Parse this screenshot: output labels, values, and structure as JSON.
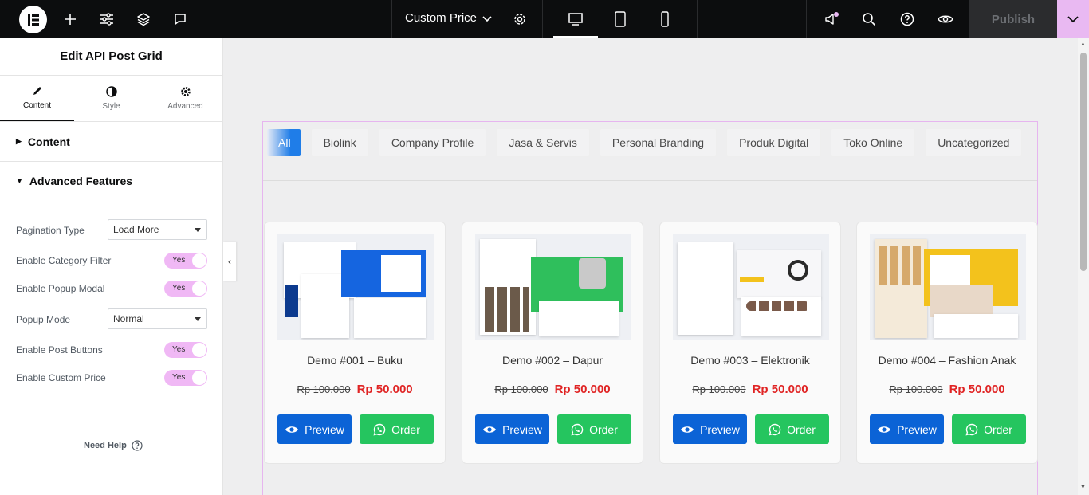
{
  "topbar": {
    "page_title": "Custom Price",
    "publish_label": "Publish",
    "icons": [
      "elementor-logo-icon",
      "add-icon",
      "settings-sliders-icon",
      "layers-icon",
      "comment-icon",
      "chevron-down-icon",
      "gear-icon",
      "desktop-icon",
      "tablet-icon",
      "mobile-icon",
      "megaphone-icon",
      "search-icon",
      "help-icon",
      "eye-icon"
    ]
  },
  "panel": {
    "title": "Edit API Post Grid",
    "tabs": [
      {
        "label": "Content",
        "icon": "pencil-icon"
      },
      {
        "label": "Style",
        "icon": "half-circle-icon"
      },
      {
        "label": "Advanced",
        "icon": "gear-icon"
      }
    ],
    "content_section": "Content",
    "advanced_section": "Advanced Features",
    "controls": {
      "pagination_type_label": "Pagination Type",
      "pagination_type_value": "Load More",
      "category_filter_label": "Enable Category Filter",
      "category_filter_value": "Yes",
      "popup_modal_label": "Enable Popup Modal",
      "popup_modal_value": "Yes",
      "popup_mode_label": "Popup Mode",
      "popup_mode_value": "Normal",
      "post_buttons_label": "Enable Post Buttons",
      "post_buttons_value": "Yes",
      "custom_price_label": "Enable Custom Price",
      "custom_price_value": "Yes"
    },
    "help": "Need Help"
  },
  "filters": [
    "All",
    "Biolink",
    "Company Profile",
    "Jasa & Servis",
    "Personal Branding",
    "Produk Digital",
    "Toko Online",
    "Uncategorized"
  ],
  "cards": [
    {
      "title": "Demo #001 – Buku",
      "old_price": "Rp 100.000",
      "price": "Rp 50.000",
      "preview": "Preview",
      "order": "Order",
      "accent": "#1565e0"
    },
    {
      "title": "Demo #002 – Dapur",
      "old_price": "Rp 100.000",
      "price": "Rp 50.000",
      "preview": "Preview",
      "order": "Order",
      "accent": "#2fbf5c"
    },
    {
      "title": "Demo #003 – Elektronik",
      "old_price": "Rp 100.000",
      "price": "Rp 50.000",
      "preview": "Preview",
      "order": "Order",
      "accent": "#e8e8ea"
    },
    {
      "title": "Demo #004 – Fashion Anak",
      "old_price": "Rp 100.000",
      "price": "Rp 50.000",
      "preview": "Preview",
      "order": "Order",
      "accent": "#f3c21c"
    }
  ],
  "colors": {
    "accent_pink": "#e9b9f2",
    "preview_blue": "#0b63d6",
    "order_green": "#25c55f",
    "price_red": "#e02424"
  }
}
